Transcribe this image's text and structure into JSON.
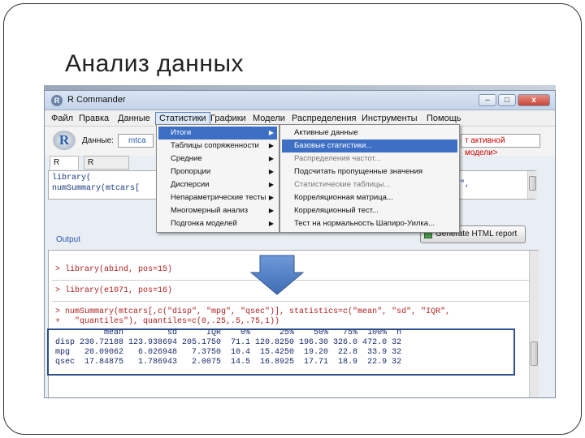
{
  "slide": {
    "title": "Анализ данных"
  },
  "window": {
    "title": "R Commander",
    "minimize": "–",
    "maximize": "□",
    "close": "x"
  },
  "menubar": {
    "items": [
      "Файл",
      "Правка",
      "Данные",
      "Статистики",
      "Графики",
      "Модели",
      "Распределения",
      "Инструменты",
      "Помощь"
    ],
    "active": "Статистики"
  },
  "toolbar": {
    "logo": "R",
    "data_label": "Данные:",
    "data_value": "mtca",
    "model_value": "т активной модели>"
  },
  "tabs": {
    "script": "R Script",
    "markdown": "R Markdown"
  },
  "script": {
    "line1": "library(",
    "line2": "numSummary(mtcars[",
    "right_fragment": "\"IQR\","
  },
  "output": {
    "label": "Output",
    "generate_button": "Generate HTML report",
    "lines": [
      "> library(abind, pos=15)",
      "> library(e1071, pos=16)",
      "> numSummary(mtcars[,c(\"disp\", \"mpg\", \"qsec\")], statistics=c(\"mean\", \"sd\", \"IQR\",",
      "+   \"quantiles\"), quantiles=c(0,.25,.5,.75,1))"
    ],
    "table_header": "          mean         sd      IQR    0%      25%    50%   75%  100%  n",
    "table_rows": [
      "disp 230.72188 123.938694 205.1750  71.1 120.8250 196.30 326.0 472.0 32",
      "mpg   20.09062   6.026948   7.3750  10.4  15.4250  19.20  22.8  33.9 32",
      "qsec  17.84875   1.786943   2.0075  14.5  16.8925  17.71  18.9  22.9 32"
    ]
  },
  "menu_stats": {
    "items": [
      "Итоги",
      "Таблицы сопряженности",
      "Средние",
      "Пропорции",
      "Дисперсии",
      "Непараметрические тесты",
      "Многомерный анализ",
      "Подгонка моделей"
    ],
    "highlighted": "Итоги"
  },
  "menu_summaries": {
    "items": [
      "Активные данные",
      "Базовые статистики...",
      "Распределения частот...",
      "Подсчитать пропущенные значения",
      "Статистические таблицы...",
      "Корреляционная матрица...",
      "Корреляционный тест...",
      "Тест на нормальность Шапиро-Уилка..."
    ],
    "highlighted": "Базовые статистики...",
    "disabled": [
      "Распределения частот...",
      "Статистические таблицы..."
    ]
  },
  "colors": {
    "accent": "#3d6fc5",
    "arrow": "#4a79c0",
    "highlight_box": "#2c4e8a"
  }
}
